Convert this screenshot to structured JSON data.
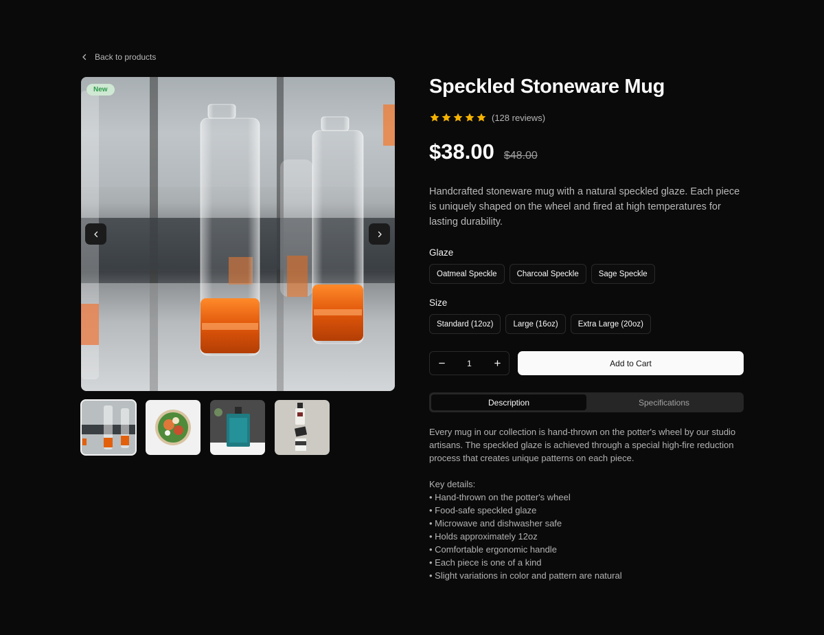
{
  "nav": {
    "back_label": "Back to products"
  },
  "gallery": {
    "badge": "New",
    "thumbnails": [
      {
        "name": "thumbnail-glass-vials",
        "active": true
      },
      {
        "name": "thumbnail-salad-bowl",
        "active": false
      },
      {
        "name": "thumbnail-perfume-bottle",
        "active": false
      },
      {
        "name": "thumbnail-stacked-bottles",
        "active": false
      }
    ]
  },
  "product": {
    "title": "Speckled Stoneware Mug",
    "rating": 5,
    "reviews": "(128 reviews)",
    "price": "$38.00",
    "old_price": "$48.00",
    "description": "Handcrafted stoneware mug with a natural speckled glaze. Each piece is uniquely shaped on the wheel and fired at high temperatures for lasting durability."
  },
  "options": {
    "glaze": {
      "label": "Glaze",
      "values": [
        "Oatmeal Speckle",
        "Charcoal Speckle",
        "Sage Speckle"
      ]
    },
    "size": {
      "label": "Size",
      "values": [
        "Standard (12oz)",
        "Large (16oz)",
        "Extra Large (20oz)"
      ]
    }
  },
  "cart": {
    "quantity": "1",
    "add_label": "Add to Cart"
  },
  "tabs": [
    {
      "label": "Description",
      "active": true
    },
    {
      "label": "Specifications",
      "active": false
    }
  ],
  "details": {
    "intro": "Every mug in our collection is hand-thrown on the potter's wheel by our studio artisans. The speckled glaze is achieved through a special high-fire reduction process that creates unique patterns on each piece.",
    "key_title": "Key details:",
    "items": [
      "• Hand-thrown on the potter's wheel",
      "• Food-safe speckled glaze",
      "• Microwave and dishwasher safe",
      "• Holds approximately 12oz",
      "• Comfortable ergonomic handle",
      "• Each piece is one of a kind",
      "• Slight variations in color and pattern are natural"
    ]
  },
  "colors": {
    "star": "#f5b301",
    "accent_orange": "#e8620a",
    "badge_bg": "#cfe8d3",
    "badge_text": "#2f9a4c"
  }
}
